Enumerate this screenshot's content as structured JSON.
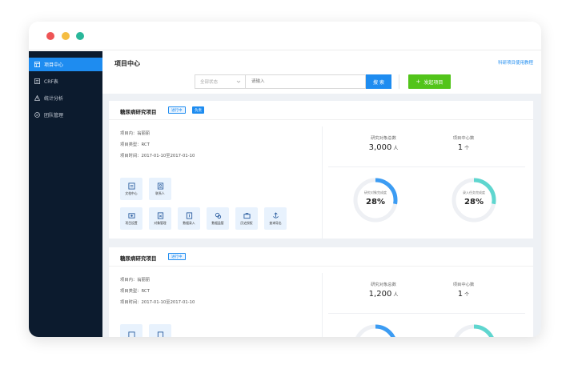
{
  "sidebar": {
    "items": [
      {
        "label": "项目中心",
        "icon": "grid-icon",
        "active": true
      },
      {
        "label": "CRF表",
        "icon": "form-icon",
        "active": false
      },
      {
        "label": "统计分析",
        "icon": "warning-icon",
        "active": false
      },
      {
        "label": "团队管理",
        "icon": "check-circle-icon",
        "active": false
      }
    ]
  },
  "header": {
    "title": "项目中心",
    "link": "科研项目使用教程",
    "status_select": "全部状态",
    "search_placeholder": "请输入",
    "search_button": "搜 索",
    "create_button": "发起项目",
    "create_icon": "+"
  },
  "projects": [
    {
      "title": "糖尿病研究项目",
      "status_badge": "进行中",
      "role_badge": "负责",
      "owner": "项目内：翁丽丽",
      "type": "项目类型：RCT",
      "time": "项目时间：2017-01-10至2017-01-10",
      "subjects_label": "研究对象总数",
      "subjects_value": "3,000",
      "subjects_unit": "人",
      "centers_label": "项目中心数",
      "centers_value": "1",
      "centers_unit": "个",
      "progress1_label": "研究对象完成度",
      "progress1_pct": "28%",
      "progress1_value": 0.28,
      "progress2_label": "录入任务完成度",
      "progress2_pct": "28%",
      "progress2_value": 0.28
    },
    {
      "title": "糖尿病研究项目",
      "status_badge": "进行中",
      "owner": "项目内：翁丽丽",
      "type": "项目类型：RCT",
      "time": "项目时间：2017-01-10至2017-01-10",
      "subjects_label": "研究对象总数",
      "subjects_value": "1,200",
      "subjects_unit": "人",
      "centers_label": "项目中心数",
      "centers_value": "1",
      "centers_unit": "个"
    }
  ],
  "functions_row1": [
    {
      "label": "文档中心",
      "icon": "document-icon"
    },
    {
      "label": "联系人",
      "icon": "contacts-icon"
    }
  ],
  "functions_row2": [
    {
      "label": "项目设置",
      "icon": "settings-icon"
    },
    {
      "label": "对象管理",
      "icon": "subject-icon"
    },
    {
      "label": "数据录入",
      "icon": "data-entry-icon"
    },
    {
      "label": "数据监管",
      "icon": "monitor-icon"
    },
    {
      "label": "历史授权",
      "icon": "history-icon"
    },
    {
      "label": "查询导出",
      "icon": "export-icon"
    }
  ],
  "colors": {
    "sidebar_bg": "#0c1b2e",
    "accent": "#1e8cf0",
    "create_green": "#52c41a",
    "donut_blue": "#3c9cf3",
    "donut_teal": "#5fd6cf",
    "donut_track": "#eef0f4"
  }
}
